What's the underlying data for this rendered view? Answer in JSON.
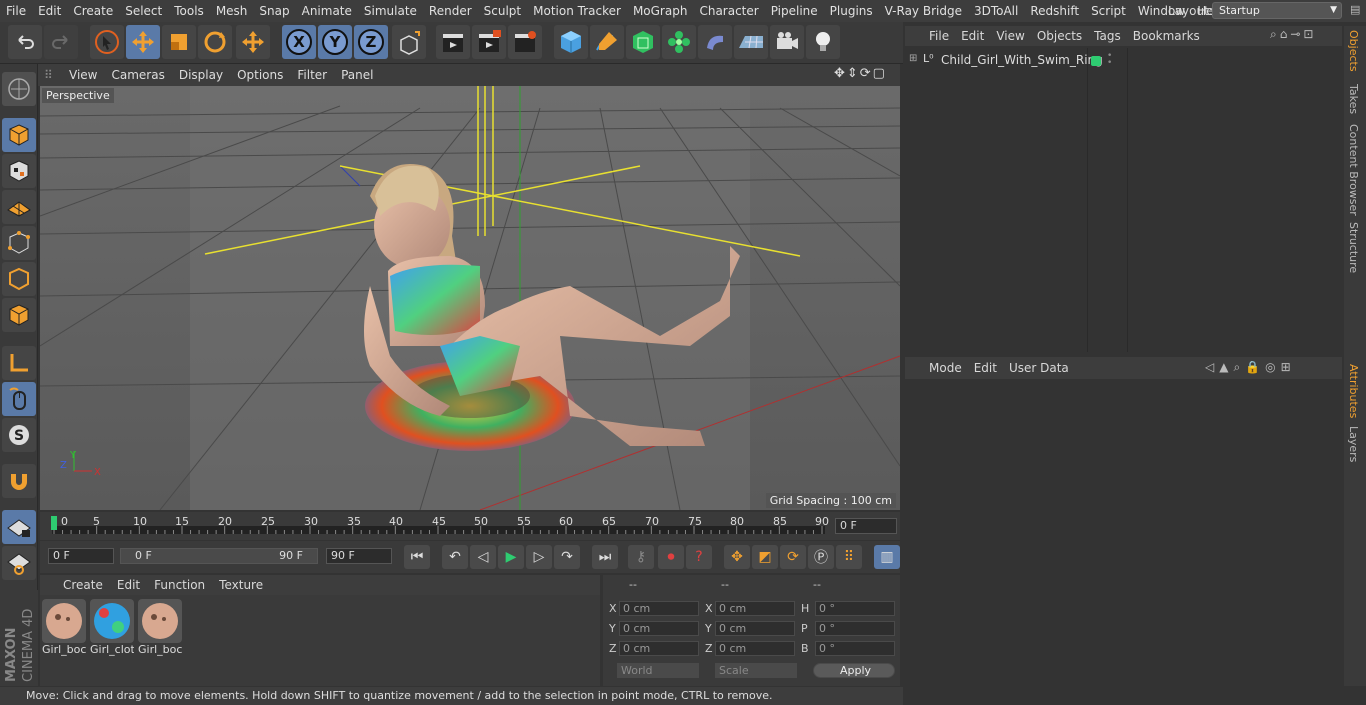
{
  "menubar": {
    "items": [
      "File",
      "Edit",
      "Create",
      "Select",
      "Tools",
      "Mesh",
      "Snap",
      "Animate",
      "Simulate",
      "Render",
      "Sculpt",
      "Motion Tracker",
      "MoGraph",
      "Character",
      "Pipeline",
      "Plugins",
      "V-Ray Bridge",
      "3DToAll",
      "Redshift",
      "Script",
      "Window",
      "Help"
    ],
    "layout_label": "Layout:",
    "layout_value": "Startup"
  },
  "viewport": {
    "menu": [
      "View",
      "Cameras",
      "Display",
      "Options",
      "Filter",
      "Panel"
    ],
    "camera": "Perspective",
    "grid_spacing": "Grid Spacing : 100 cm",
    "axis_x": "X",
    "axis_y": "Y",
    "axis_z": "Z"
  },
  "timeline": {
    "ticks": [
      "0",
      "5",
      "10",
      "15",
      "20",
      "25",
      "30",
      "35",
      "40",
      "45",
      "50",
      "55",
      "60",
      "65",
      "70",
      "75",
      "80",
      "85",
      "90"
    ],
    "current_frame": "0 F"
  },
  "transport": {
    "start_field": "0 F",
    "range_start": "0 F",
    "range_end": "90 F",
    "end_field": "90 F"
  },
  "materials": {
    "menu": [
      "Create",
      "Edit",
      "Function",
      "Texture"
    ],
    "items": [
      {
        "label": "Girl_boc"
      },
      {
        "label": "Girl_clot"
      },
      {
        "label": "Girl_boc"
      }
    ]
  },
  "coordinates": {
    "headers": [
      "--",
      "--",
      "--"
    ],
    "rows": [
      {
        "a_label": "X",
        "a_val": "0 cm",
        "b_label": "X",
        "b_val": "0 cm",
        "c_label": "H",
        "c_val": "0 °"
      },
      {
        "a_label": "Y",
        "a_val": "0 cm",
        "b_label": "Y",
        "b_val": "0 cm",
        "c_label": "P",
        "c_val": "0 °"
      },
      {
        "a_label": "Z",
        "a_val": "0 cm",
        "b_label": "Z",
        "b_val": "0 cm",
        "c_label": "B",
        "c_val": "0 °"
      }
    ],
    "world_select": "World",
    "scale_select": "Scale",
    "apply_label": "Apply"
  },
  "objects": {
    "menu": [
      "File",
      "Edit",
      "View",
      "Objects",
      "Tags",
      "Bookmarks"
    ],
    "tree_item": "Child_Girl_With_Swim_Ring",
    "tag_color": "#2ecc71"
  },
  "attributes": {
    "menu": [
      "Mode",
      "Edit",
      "User Data"
    ]
  },
  "sidetabs": {
    "top": [
      "Objects",
      "Takes",
      "Content Browser",
      "Structure"
    ],
    "bottom": [
      "Attributes",
      "Layers"
    ]
  },
  "brand": {
    "line1": "MAXON",
    "line2": "CINEMA 4D"
  },
  "status": {
    "text": "Move: Click and drag to move elements. Hold down SHIFT to quantize movement / add to the selection in point mode, CTRL to remove."
  },
  "colors": {
    "accent": "#5a7aa8",
    "highlight_orange": "#f0a030"
  }
}
